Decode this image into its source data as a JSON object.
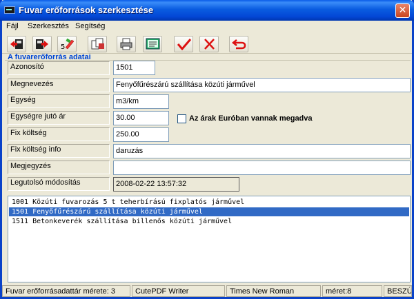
{
  "window": {
    "title": "Fuvar erőforrások szerkesztése",
    "close_glyph": "✕"
  },
  "menu": {
    "items": [
      {
        "label": "Fájl"
      },
      {
        "label": "Szerkesztés"
      },
      {
        "label": "Segítség"
      }
    ]
  },
  "toolbar": {
    "buttons": [
      {
        "icon": "import-icon"
      },
      {
        "icon": "export-icon"
      },
      {
        "icon": "edit-icon"
      },
      {
        "icon": "copy-icon"
      },
      {
        "icon": "print-icon"
      },
      {
        "icon": "preview-icon"
      },
      {
        "icon": "checkmark-icon"
      },
      {
        "icon": "cancel-x-icon"
      },
      {
        "icon": "undo-arrow-icon"
      }
    ]
  },
  "group": {
    "title": "A fuvarerőforrás adatai"
  },
  "fields": {
    "azonosito": {
      "label": "Azonosító",
      "value": "1501"
    },
    "megnevezes": {
      "label": "Megnevezés",
      "value": "Fenyőfűrészárú szállítása közúti járművel"
    },
    "egyseg": {
      "label": "Egység",
      "value": "m3/km"
    },
    "egysegar": {
      "label": "Egységre jutó ár",
      "value": "30.00"
    },
    "fix_koltseg": {
      "label": "Fix költség",
      "value": "250.00"
    },
    "fix_info": {
      "label": "Fix költség info",
      "value": "daruzás"
    },
    "megjegyzes": {
      "label": "Megjegyzés",
      "value": ""
    },
    "modositas": {
      "label": "Legutolsó módosítás",
      "value": "2008-02-22 13:57:32"
    }
  },
  "euro_checkbox": {
    "label": "Az árak Euróban vannak megadva",
    "checked": false
  },
  "list": {
    "rows": [
      {
        "text": "1001 Közúti fuvarozás 5 t teherbírású fixplatós járművel",
        "selected": false
      },
      {
        "text": "1501 Fenyőfűrészárú szállítása közúti járművel",
        "selected": true
      },
      {
        "text": "1511 Betonkeverék szállítása billenős közúti járművel",
        "selected": false
      }
    ]
  },
  "status": {
    "count": "Fuvar erőforrásadattár mérete: 3",
    "printer": "CutePDF Writer",
    "font": "Times New Roman",
    "size": "méret:8",
    "mode": "BESZÚR"
  }
}
